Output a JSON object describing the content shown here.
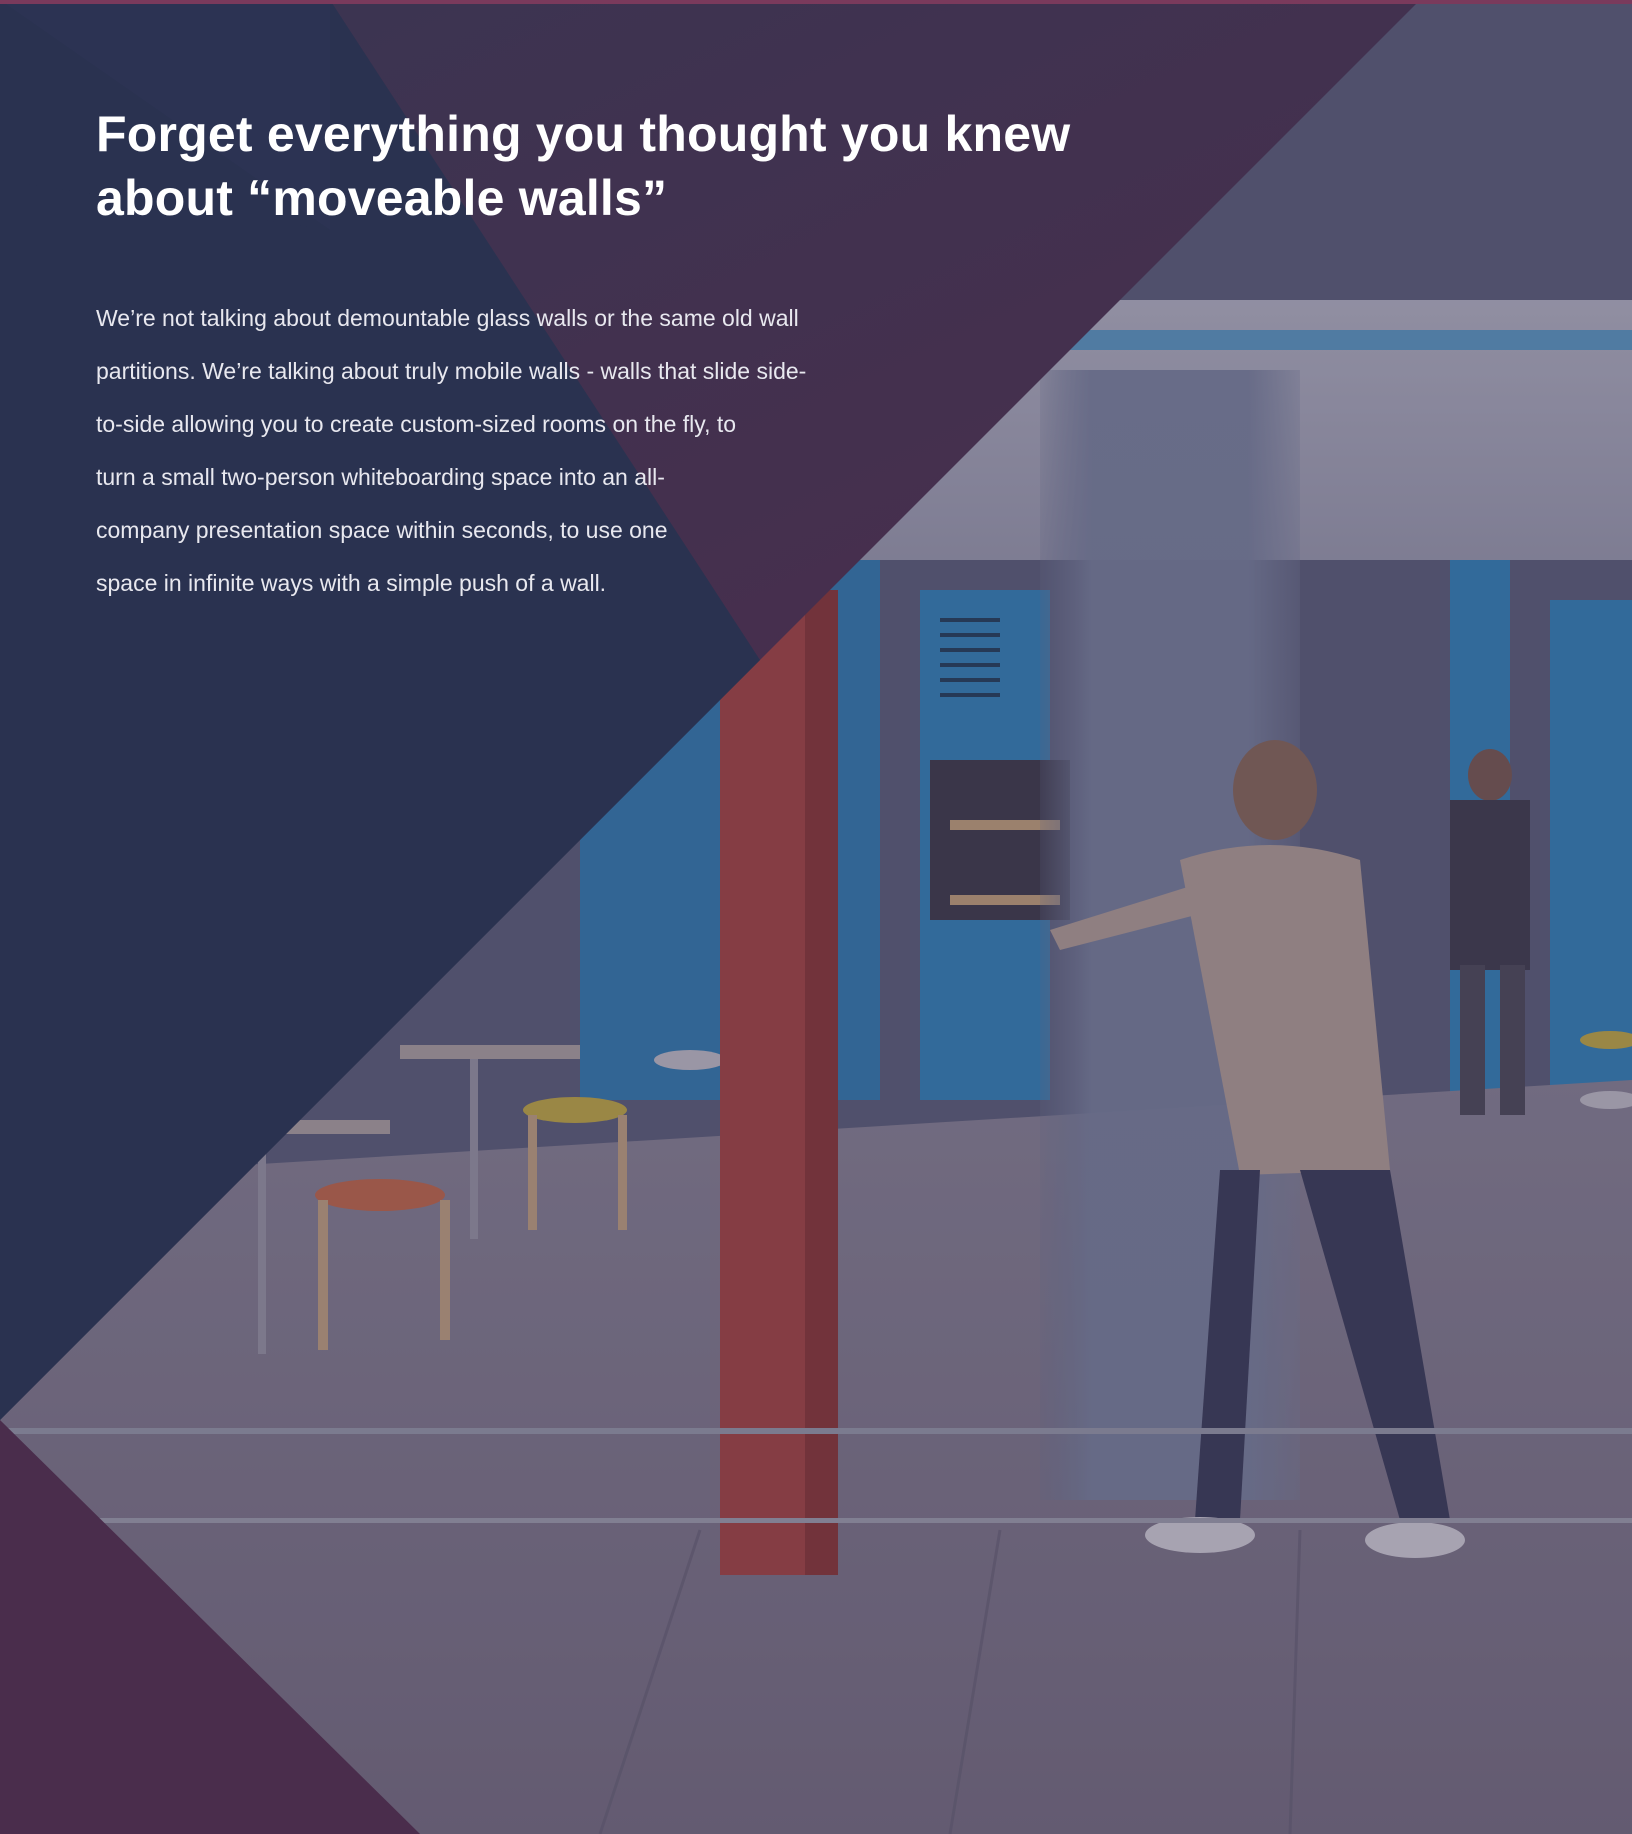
{
  "headline": {
    "line1": "Forget everything you thought you knew",
    "line2": "about “moveable walls”"
  },
  "body": {
    "lines": [
      "We’re not talking about demountable glass walls or the same old wall",
      "partitions. We’re talking about truly mobile walls - walls that slide side-",
      "to-side allowing you to create custom-sized rooms on the fly, to",
      "turn a small two-person whiteboarding space into an all-",
      "company presentation space within seconds, to use one",
      "space in infinite ways with a simple push of a wall."
    ]
  },
  "colors": {
    "navy": "#2a3250",
    "plum": "#4a2d4c",
    "accent": "#7a3a5c",
    "text": "#ffffff"
  }
}
